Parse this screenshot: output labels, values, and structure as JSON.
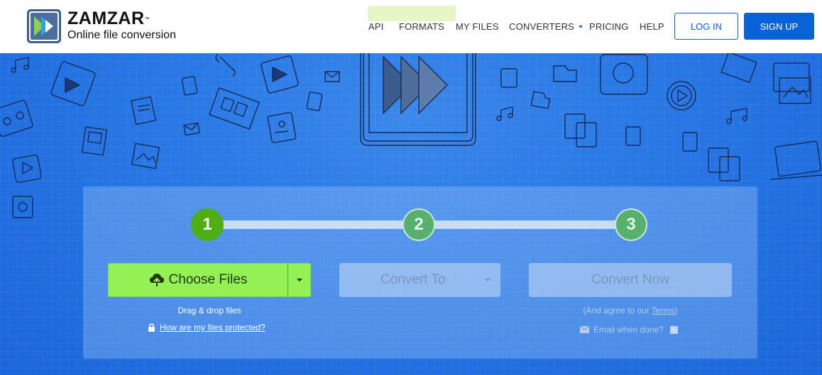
{
  "brand": {
    "name": "ZAMZAR",
    "trademark": "™",
    "tagline": "Online file conversion"
  },
  "nav": {
    "items": [
      {
        "label": "API"
      },
      {
        "label": "FORMATS"
      },
      {
        "label": "MY FILES"
      },
      {
        "label": "CONVERTERS",
        "has_dropdown": true
      },
      {
        "label": "PRICING"
      },
      {
        "label": "HELP"
      }
    ],
    "login_label": "LOG IN",
    "signup_label": "SIGN UP"
  },
  "converter": {
    "steps": [
      "1",
      "2",
      "3"
    ],
    "active_step": 1,
    "choose_files_label": "Choose Files",
    "convert_to_label": "Convert To",
    "convert_now_label": "Convert Now",
    "drag_drop_text": "Drag & drop files",
    "protected_link": "How are my files protected?",
    "agree_prefix": "(And agree to our ",
    "terms_label": "Terms",
    "agree_suffix": ")",
    "email_label": "Email when done?",
    "email_checked": false
  },
  "colors": {
    "accent_blue": "#0a63d6",
    "hero_blue": "#1f6fe0",
    "step_active": "#4fae12",
    "choose_green": "#93f055"
  },
  "icons": [
    "logo-mark-icon",
    "cloud-upload-icon",
    "chevron-down-icon",
    "lock-icon",
    "envelope-icon",
    "music-icon",
    "video-icon",
    "image-icon",
    "folder-icon",
    "mail-icon",
    "wrench-icon",
    "film-icon"
  ]
}
